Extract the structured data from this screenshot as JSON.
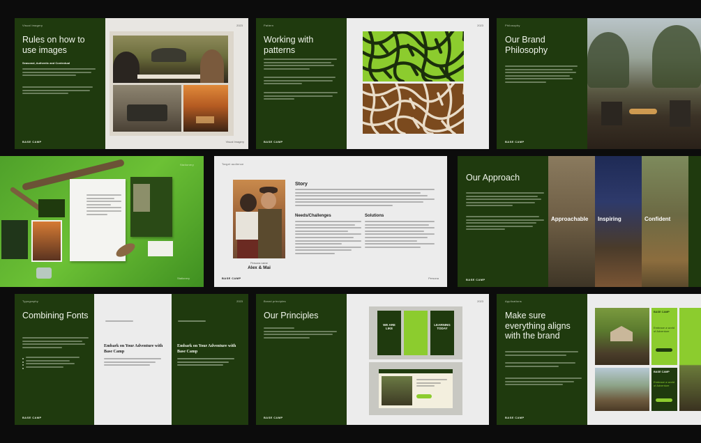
{
  "brand": "BASE CAMP",
  "slides": {
    "images": {
      "label": "Visual Imagery",
      "title": "Rules on how to use images",
      "subtitle": "Seasonal, Authentic and Contextual",
      "page": "2023",
      "footer": "Visual Imagery"
    },
    "patterns": {
      "label": "Pattern",
      "title": "Working with patterns",
      "page": "2023"
    },
    "philosophy": {
      "label": "Philosophy",
      "title": "Our Brand Philosophy"
    },
    "mockup": {
      "label": "Stationery"
    },
    "persona": {
      "label": "Target audience",
      "name_label": "Persona name",
      "name": "Alex & Mai",
      "story_heading": "Story",
      "needs_heading": "Needs/Challenges",
      "solutions_heading": "Solutions"
    },
    "approach": {
      "title": "Our Approach",
      "panels": [
        "Approachable",
        "Inspiring",
        "Confident"
      ]
    },
    "fonts": {
      "label": "Typography",
      "title": "Combining Fonts",
      "page": "2023",
      "sample_text": "Embark on Your Adventure with Base Camp",
      "sample_text_dark": "Embark on Your Adventure with Base Camp"
    },
    "principles": {
      "label": "Brand principles",
      "title": "Our Principles",
      "page": "2023",
      "card_1": "WE ARE LIKE",
      "card_2": "LEARNING TODAY"
    },
    "align": {
      "label": "Applications",
      "title": "Make sure everything aligns with the brand",
      "card_brand": "BASE CAMP",
      "card_line": "Embrace a world of Adventure"
    }
  },
  "colors": {
    "forest": "#1f3a0e",
    "lime": "#8ccc2e",
    "light": "#ececec",
    "bark": "#7b4a1e"
  }
}
